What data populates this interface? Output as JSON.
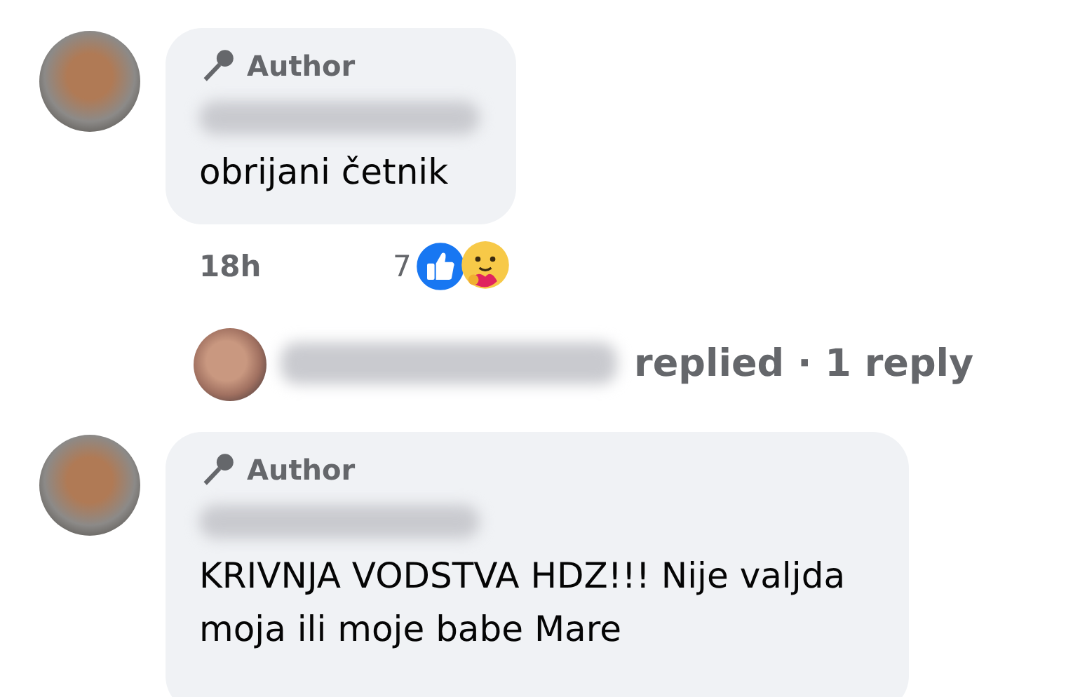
{
  "comments": [
    {
      "badge": "Author",
      "text": "obrijani četnik",
      "time": "18h",
      "reaction_count": "7",
      "reply_summary": "replied · 1 reply"
    },
    {
      "badge": "Author",
      "text": "KRIVNJA VODSTVA HDZ!!! Nije valjda moja ili moje babe Mare"
    }
  ]
}
